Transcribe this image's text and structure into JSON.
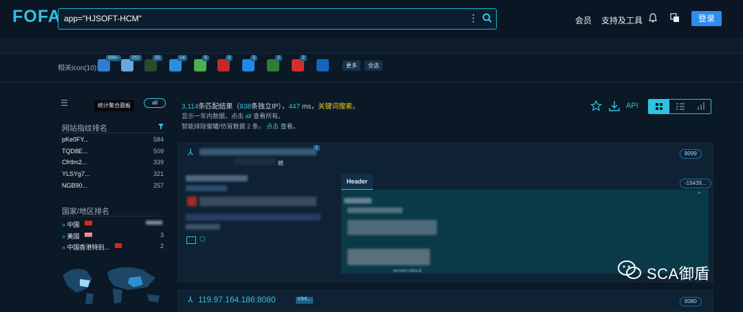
{
  "header": {
    "logo": "FOFA",
    "search_value": "app=\"HJSOFT-HCM\"",
    "nav": [
      "会员",
      "支持及工具"
    ],
    "login_label": "登录"
  },
  "related_icons": {
    "label": "相关icon(10):",
    "items": [
      {
        "badge": "999+",
        "color": "#2d7fd4"
      },
      {
        "badge": "152",
        "color": "#6aa6d8"
      },
      {
        "badge": "32",
        "color": "#2a4a2c"
      },
      {
        "badge": "14",
        "color": "#2d8ee0"
      },
      {
        "badge": "5",
        "color": "#4caf50"
      },
      {
        "badge": "3",
        "color": "#c62828"
      },
      {
        "badge": "3",
        "color": "#1e88e5"
      },
      {
        "badge": "2",
        "color": "#2e7d32"
      },
      {
        "badge": "2",
        "color": "#d32f2f"
      },
      {
        "badge": "",
        "color": "#1565c0"
      }
    ],
    "more_label": "更多",
    "select_all_label": "全选"
  },
  "sidebar": {
    "tooltip": "统计聚合面板",
    "all_label": "all",
    "fingerprint_title": "网站指纹排名",
    "fingerprints": [
      {
        "name": "pKe0FY...",
        "count": "584"
      },
      {
        "name": "TQD8E...",
        "count": "509"
      },
      {
        "name": "Cfrtlm2...",
        "count": "339"
      },
      {
        "name": "YLSYg7...",
        "count": "321"
      },
      {
        "name": "NGB90...",
        "count": "257"
      }
    ],
    "country_title": "国家/地区排名",
    "countries": [
      {
        "name": "中国",
        "count": ""
      },
      {
        "name": "美国",
        "count": "3"
      },
      {
        "name": "中国香港特别...",
        "count": "2"
      }
    ]
  },
  "stats": {
    "total": "3,114",
    "total_suffix": "条匹配结果（",
    "ip_count": "938",
    "ip_suffix": "条独立IP），",
    "ms": "447",
    "ms_suffix": "ms，",
    "keyword_search": "关键词搜索。",
    "line2_prefix": "显示一年内数据，点击",
    "line2_link": "all",
    "line2_suffix": "查看所有。",
    "line3_prefix": "智能排除蜜罐/仿冒数据",
    "line3_count": "2",
    "line3_mid": "条。",
    "line3_link": "点击",
    "line3_suffix": "查看。"
  },
  "toolbar": {
    "api_label": "API"
  },
  "results": [
    {
      "port": "8099",
      "title_fragment": "统",
      "header_tab": "Header",
      "tag": "-19439...",
      "body_fragment": "vender=block"
    },
    {
      "ip": "119.97.164.186:8080",
      "tag_name": "Cfrtl...",
      "port": "8080"
    }
  ],
  "watermark": {
    "text": "SCA御盾"
  },
  "colors": {
    "accent": "#2ec4e0",
    "background": "#0b1826",
    "login": "#2d8cf0",
    "highlight": "#f2d11c"
  }
}
